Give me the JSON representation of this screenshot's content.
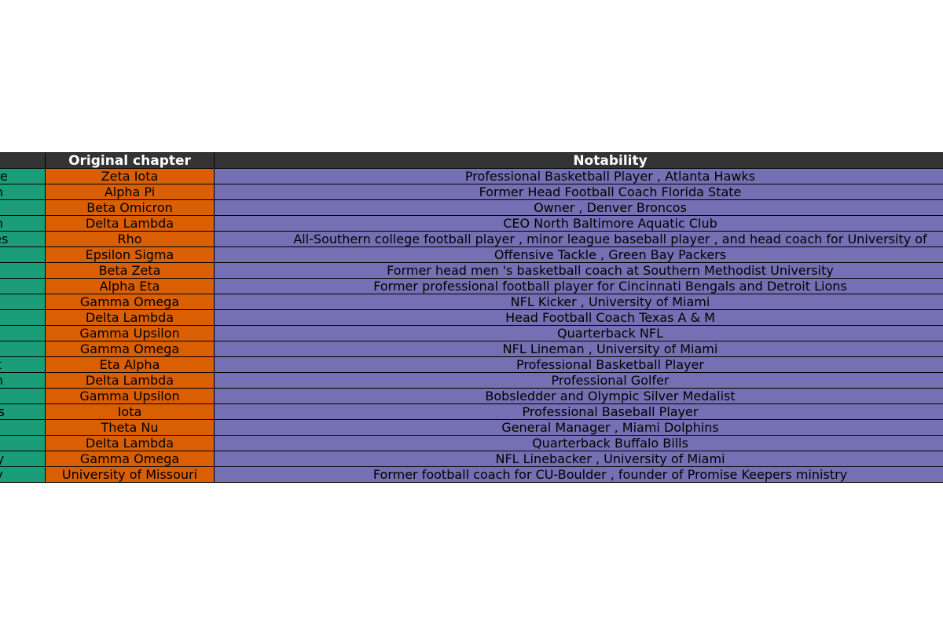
{
  "chart_data": {
    "type": "table",
    "columns": [
      "",
      "Original chapter",
      "Notability"
    ],
    "rows": [
      [
        "more",
        "Zeta Iota",
        "Professional Basketball Player , Atlanta Hawks"
      ],
      [
        "den",
        "Alpha Pi",
        "Former Head Football Coach Florida State"
      ],
      [
        "en",
        "Beta Omicron",
        "Owner , Denver Broncos"
      ],
      [
        "nan",
        "Delta Lambda",
        "CEO North Baltimore Aquatic Club"
      ],
      [
        "idges",
        "Rho",
        "All-Southern college football player , minor league baseball player , and head coach for University of"
      ],
      [
        "on",
        "Epsilon Sigma",
        "Offensive Tackle , Green Bay Packers"
      ],
      [
        "rty",
        "Beta Zeta",
        "Former head men 's basketball coach at Southern Methodist University"
      ],
      [
        "nis",
        "Alpha Eta",
        "Former professional football player for Cincinnati Bengals and Detroit Lions"
      ],
      [
        "es",
        "Gamma Omega",
        "NFL Kicker , University of Miami"
      ],
      [
        "er",
        "Delta Lambda",
        "Head Football Coach Texas A & M"
      ],
      [
        "tte",
        "Gamma Upsilon",
        "Quarterback NFL"
      ],
      [
        "x",
        "Gamma Omega",
        "NFL Lineman , University of Miami"
      ],
      [
        "ant",
        "Eta Alpha",
        "Professional Basketball Player"
      ],
      [
        "een",
        "Delta Lambda",
        "Professional Golfer"
      ],
      [
        "ys",
        "Gamma Upsilon",
        "Bobsledder and Olympic Silver Medalist"
      ],
      [
        "reys",
        "Iota",
        "Professional Baseball Player"
      ],
      [
        "nd",
        "Theta Nu",
        "General Manager , Miami Dolphins"
      ],
      [
        "el",
        "Delta Lambda",
        "Quarterback Buffalo Bills"
      ],
      [
        "rthy",
        "Gamma Omega",
        "NFL Linebacker , University of Miami"
      ],
      [
        "ney",
        "University of Missouri",
        "Former football coach for CU-Boulder , founder of Promise Keepers ministry"
      ]
    ],
    "colors": {
      "header_bg": "#333333",
      "header_text": "#ffffff",
      "column_bg": [
        "#1b9e77",
        "#d95f02",
        "#7570b3"
      ],
      "border": "#000000"
    }
  }
}
